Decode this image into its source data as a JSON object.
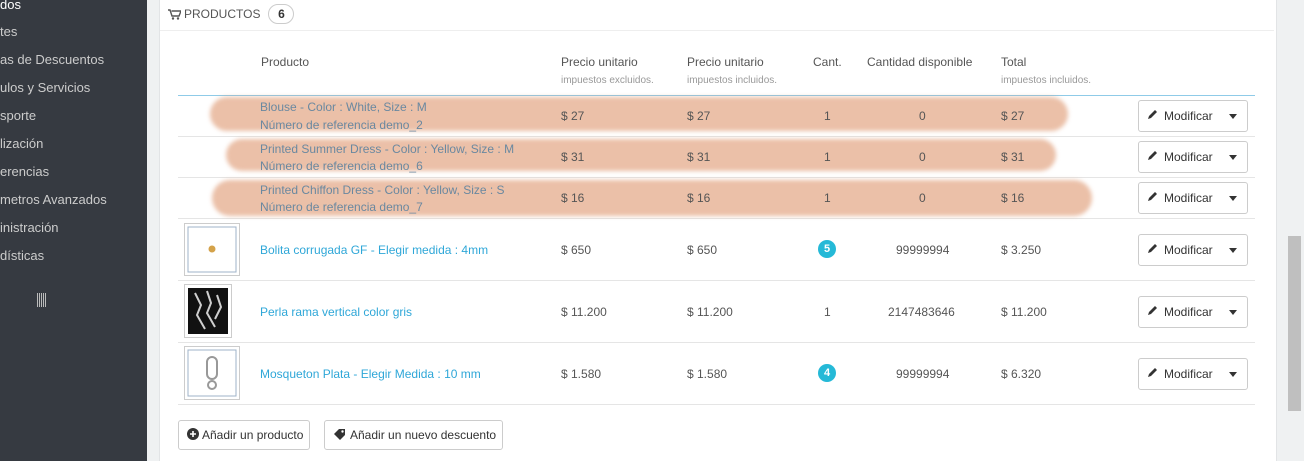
{
  "sidebar": {
    "items": [
      {
        "label": "dos",
        "active": true
      },
      {
        "label": "tes",
        "active": false
      },
      {
        "label": "as de Descuentos",
        "active": false
      },
      {
        "label": "ulos y Servicios",
        "active": false
      },
      {
        "label": "sporte",
        "active": false
      },
      {
        "label": "lización",
        "active": false
      },
      {
        "label": "erencias",
        "active": false
      },
      {
        "label": "metros Avanzados",
        "active": false
      },
      {
        "label": "inistración",
        "active": false
      },
      {
        "label": "dísticas",
        "active": false
      }
    ]
  },
  "panel": {
    "title": "PRODUCTOS",
    "count": "6"
  },
  "table": {
    "headers": {
      "product": "Producto",
      "unit_excl": "Precio unitario",
      "unit_excl_sub": "impuestos excluidos.",
      "unit_incl": "Precio unitario",
      "unit_incl_sub": "impuestos incluidos.",
      "qty": "Cant.",
      "available": "Cantidad disponible",
      "total": "Total",
      "total_sub": "impuestos incluidos."
    },
    "rows": [
      {
        "name": "Blouse - Color : White, Size : M",
        "ref": "Número de referencia demo_2",
        "price_excl": "$ 27",
        "price_incl": "$ 27",
        "qty": "1",
        "available": "0",
        "total": "$ 27",
        "action": "Modificar"
      },
      {
        "name": "Printed Summer Dress - Color : Yellow, Size : M",
        "ref": "Número de referencia demo_6",
        "price_excl": "$ 31",
        "price_incl": "$ 31",
        "qty": "1",
        "available": "0",
        "total": "$ 31",
        "action": "Modificar"
      },
      {
        "name": "Printed Chiffon Dress - Color : Yellow, Size : S",
        "ref": "Número de referencia demo_7",
        "price_excl": "$ 16",
        "price_incl": "$ 16",
        "qty": "1",
        "available": "0",
        "total": "$ 16",
        "action": "Modificar"
      },
      {
        "name": "Bolita corrugada GF - Elegir medida : 4mm",
        "price_excl": "$ 650",
        "price_incl": "$ 650",
        "qty": "5",
        "available": "99999994",
        "total": "$ 3.250",
        "action": "Modificar"
      },
      {
        "name": "Perla rama vertical color gris",
        "price_excl": "$ 11.200",
        "price_incl": "$ 11.200",
        "qty": "1",
        "available": "2147483646",
        "total": "$ 11.200",
        "action": "Modificar"
      },
      {
        "name": "Mosqueton Plata - Elegir Medida : 10 mm",
        "price_excl": "$ 1.580",
        "price_incl": "$ 1.580",
        "qty": "4",
        "available": "99999994",
        "total": "$ 6.320",
        "action": "Modificar"
      }
    ]
  },
  "actions": {
    "add_product": "Añadir un producto",
    "add_discount": "Añadir un nuevo descuento"
  },
  "colors": {
    "accent": "#25b9d7",
    "link": "#2fa7d8",
    "sidebar_bg": "#363a41",
    "redaction": "#de966e"
  },
  "icons": [
    "cart-icon",
    "pencil-icon",
    "caret-down-icon",
    "plus-circle-icon",
    "tag-icon",
    "barcode-icon"
  ]
}
